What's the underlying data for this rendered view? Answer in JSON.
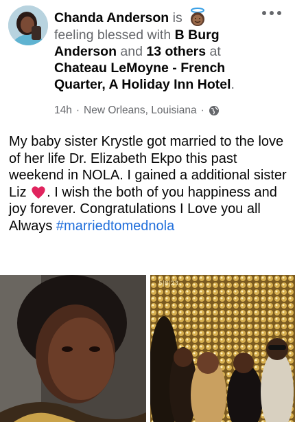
{
  "post": {
    "author": "Chanda Anderson",
    "verb": " is ",
    "feeling": "feeling blessed with ",
    "tag_person": "B Burg Anderson",
    "and_text": " and ",
    "others": "13 others",
    "at_text": " at ",
    "place": "Chateau LeMoyne - French Quarter, A Holiday Inn Hotel",
    "period": ".",
    "time": "14h",
    "sep1": "·",
    "location": "New Orleans, Louisiana",
    "sep2": "·",
    "privacy_icon": "globe-icon",
    "menu_icon": "more-horizontal-icon",
    "feeling_icon": "smiling-face-with-halo-icon"
  },
  "body": {
    "text": "My baby sister Krystle got married to the love of her life Dr. Elizabeth Ekpo this past weekend in NOLA. I gained a additional sister Liz ",
    "text_after_heart": ". I wish the both of you happiness and joy forever. Congratulations I Love you all Always ",
    "hashtag": "#marriedtomednola",
    "heart_icon": "red-heart-icon"
  },
  "photos": {
    "right_badge": "5|8|23"
  },
  "colors": {
    "text": "#050505",
    "secondary": "#65676b",
    "link": "#216fdb",
    "heart": "#e0245e",
    "gold": "#c9a24a"
  }
}
